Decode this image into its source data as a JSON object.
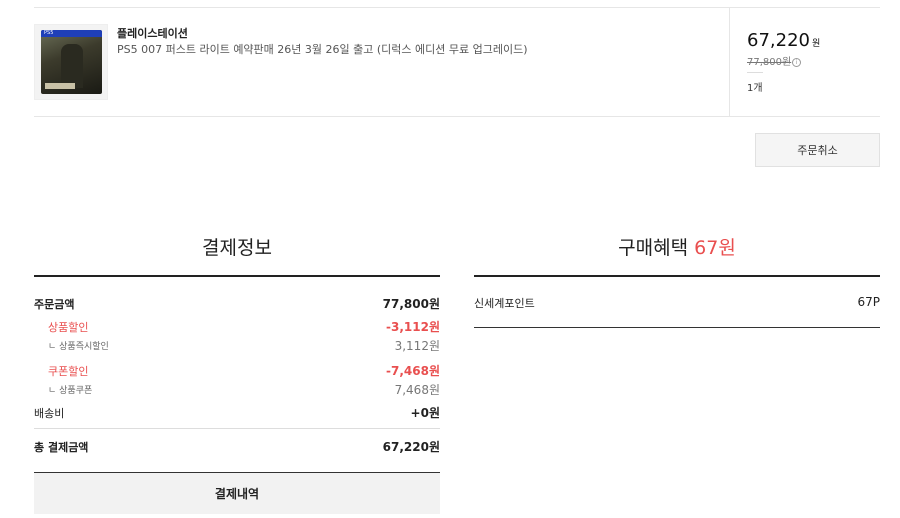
{
  "product": {
    "brand": "플레이스테이션",
    "name": "PS5 007 퍼스트 라이트 예약판매 26년 3월 26일 출고 (디럭스 에디션 무료 업그레이드)",
    "cover_badge": "PS5",
    "price": "67,220",
    "price_unit": "원",
    "original_price": "77,800원",
    "quantity": "1개"
  },
  "cancel_button": "주문취소",
  "payment": {
    "title": "결제정보",
    "rows": [
      {
        "label": "주문금액",
        "value": "77,800원"
      },
      {
        "label": "상품할인",
        "value": "-3,112원"
      },
      {
        "label": "ㄴ 상품즉시할인",
        "value": "3,112원"
      },
      {
        "label": "쿠폰할인",
        "value": "-7,468원"
      },
      {
        "label": "ㄴ 상품쿠폰",
        "value": "7,468원"
      },
      {
        "label": "배송비",
        "value": "+0원"
      }
    ],
    "total_label": "총 결제금액",
    "total_value": "67,220원",
    "detail_button": "결제내역"
  },
  "benefit": {
    "title": "구매혜택",
    "title_amount": "67원",
    "point_label": "신세계포인트",
    "point_value": "67P"
  },
  "colors": {
    "accent_red": "#e94f4f"
  }
}
